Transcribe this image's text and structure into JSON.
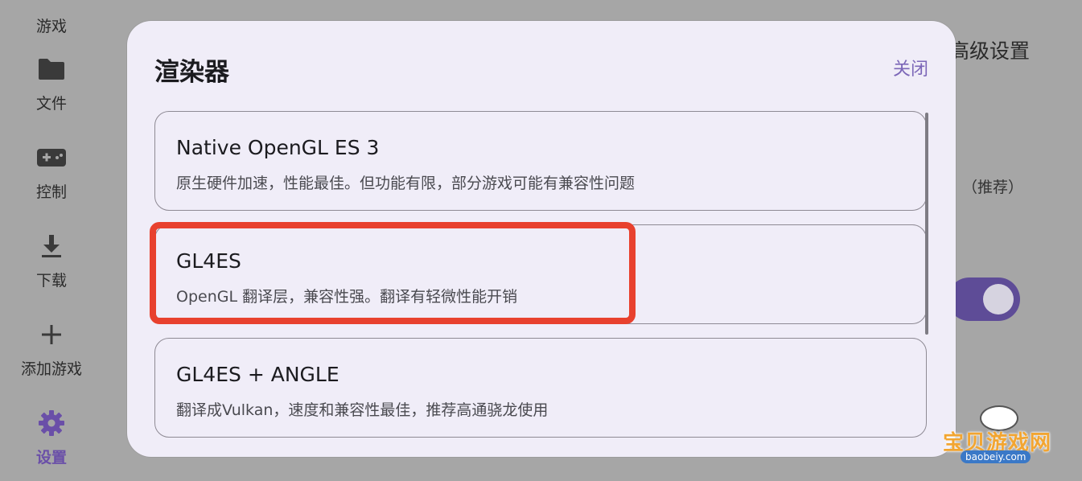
{
  "sidebar": {
    "items": [
      {
        "label": "游戏",
        "icon": "gamepad-icon"
      },
      {
        "label": "文件",
        "icon": "folder-icon"
      },
      {
        "label": "控制",
        "icon": "controller-icon"
      },
      {
        "label": "下载",
        "icon": "download-icon"
      },
      {
        "label": "添加游戏",
        "icon": "plus-icon"
      },
      {
        "label": "设置",
        "icon": "gear-icon",
        "active": true
      }
    ]
  },
  "background": {
    "title": "高级设置",
    "recommend": "（推荐）",
    "toggle_on": true
  },
  "dialog": {
    "title": "渲染器",
    "close_label": "关闭",
    "options": [
      {
        "title": "Native OpenGL ES 3",
        "desc": "原生硬件加速，性能最佳。但功能有限，部分游戏可能有兼容性问题"
      },
      {
        "title": "GL4ES",
        "desc": "OpenGL 翻译层，兼容性强。翻译有轻微性能开销",
        "highlighted": true
      },
      {
        "title": "GL4ES + ANGLE",
        "desc": "翻译成Vulkan，速度和兼容性最佳，推荐高通骁龙使用"
      }
    ]
  },
  "colors": {
    "accent": "#6a4fa8",
    "highlight": "#e8412e",
    "dialog_bg": "#f0edf8"
  },
  "watermark": {
    "text": "宝贝游戏网",
    "url": "baobeiy.com"
  }
}
